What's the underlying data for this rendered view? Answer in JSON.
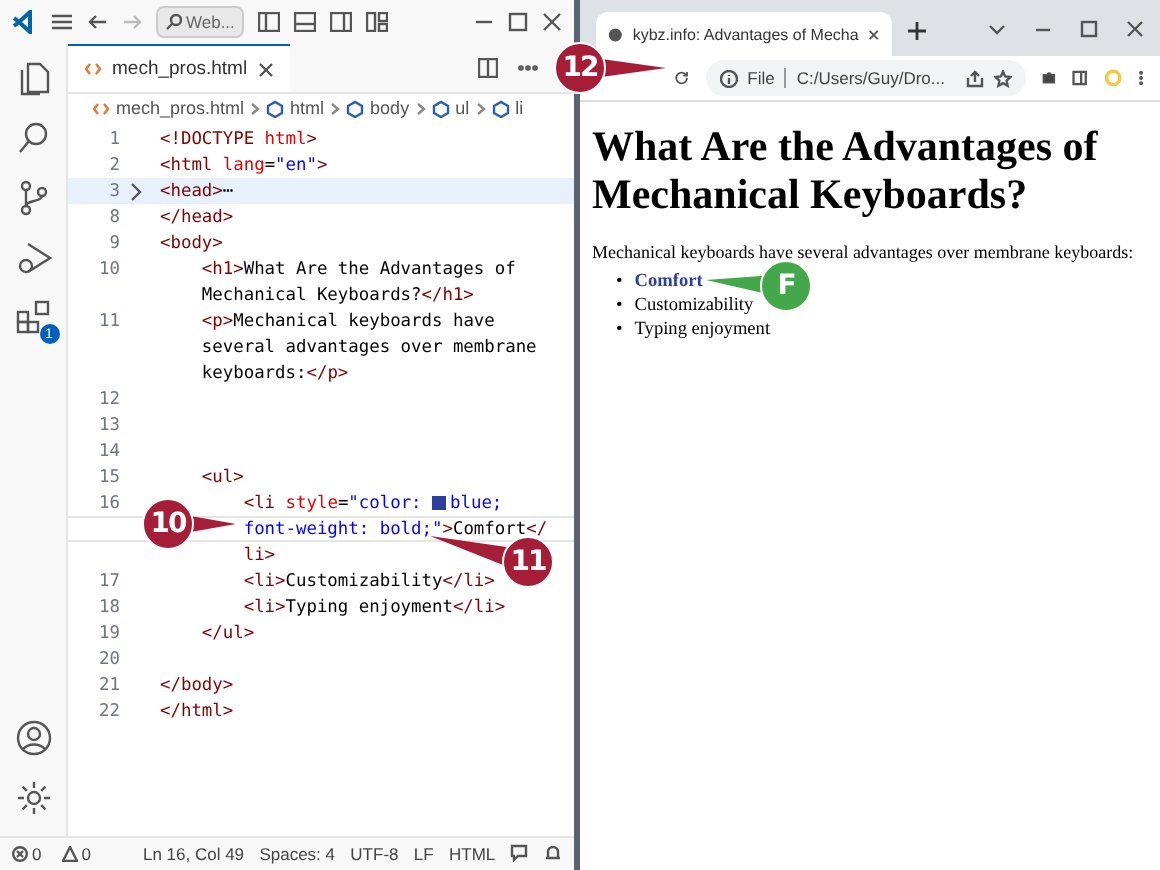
{
  "editor": {
    "search": "Web...",
    "tab": {
      "label": "mech_pros.html",
      "selected": true
    },
    "breadcrumb": [
      "mech_pros.html",
      "html",
      "body",
      "ul",
      "li"
    ],
    "extensions_badge": "1",
    "lines": [
      {
        "number": "1",
        "tokens": [
          {
            "text": "<!DOCTYPE",
            "kind": "tag"
          },
          {
            "text": " html",
            "kind": "attr"
          },
          {
            "text": ">",
            "kind": "tag"
          }
        ]
      },
      {
        "number": "2",
        "tokens": [
          {
            "text": "<html",
            "kind": "tag"
          },
          {
            "text": " lang",
            "kind": "attr"
          },
          {
            "text": "=",
            "kind": "text"
          },
          {
            "text": "\"en\"",
            "kind": "value"
          },
          {
            "text": ">",
            "kind": "tag"
          }
        ]
      },
      {
        "number": "3",
        "folded": true,
        "tokens": [
          {
            "text": "<head>",
            "kind": "tag"
          },
          {
            "text": "⋯",
            "kind": "text"
          }
        ]
      },
      {
        "number": "8",
        "tokens": [
          {
            "text": "</head>",
            "kind": "tag"
          }
        ]
      },
      {
        "number": "9",
        "tokens": [
          {
            "text": "<body>",
            "kind": "tag"
          }
        ]
      },
      {
        "number": "10",
        "tokens": [
          {
            "text": "    <h1>",
            "kind": "tag"
          },
          {
            "text": "What Are the Advantages of",
            "kind": "text"
          }
        ]
      },
      {
        "tokens": [
          {
            "text": "    Mechanical Keyboards?",
            "kind": "text"
          },
          {
            "text": "</h1>",
            "kind": "tag"
          }
        ]
      },
      {
        "number": "11",
        "tokens": [
          {
            "text": "    <p>",
            "kind": "tag"
          },
          {
            "text": "Mechanical keyboards have",
            "kind": "text"
          }
        ]
      },
      {
        "tokens": [
          {
            "text": "    several advantages over membrane",
            "kind": "text"
          }
        ]
      },
      {
        "tokens": [
          {
            "text": "    keyboards:",
            "kind": "text"
          },
          {
            "text": "</p>",
            "kind": "tag"
          }
        ]
      },
      {
        "number": "12"
      },
      {
        "number": "13"
      },
      {
        "number": "14"
      },
      {
        "number": "15",
        "tokens": [
          {
            "text": "    <ul>",
            "kind": "tag"
          }
        ]
      },
      {
        "number": "16",
        "tokens": [
          {
            "text": "        <li",
            "kind": "tag"
          },
          {
            "text": " style",
            "kind": "attr"
          },
          {
            "text": "=",
            "kind": "text"
          },
          {
            "text": "\"color: ",
            "kind": "value"
          },
          {
            "kind": "swatch",
            "color": "#2b3f9e"
          },
          {
            "text": "blue;",
            "kind": "value"
          }
        ]
      },
      {
        "current": true,
        "tokens": [
          {
            "text": "        font-weight: bold;\"",
            "kind": "value"
          },
          {
            "text": ">",
            "kind": "tag"
          },
          {
            "text": "Comfort",
            "kind": "text"
          },
          {
            "text": "</",
            "kind": "tag"
          }
        ]
      },
      {
        "tokens": [
          {
            "text": "        li>",
            "kind": "tag"
          }
        ]
      },
      {
        "number": "17",
        "tokens": [
          {
            "text": "        <li>",
            "kind": "tag"
          },
          {
            "text": "Customizability",
            "kind": "text"
          },
          {
            "text": "</li>",
            "kind": "tag"
          }
        ]
      },
      {
        "number": "18",
        "tokens": [
          {
            "text": "        <li>",
            "kind": "tag"
          },
          {
            "text": "Typing enjoyment",
            "kind": "text"
          },
          {
            "text": "</li>",
            "kind": "tag"
          }
        ]
      },
      {
        "number": "19",
        "tokens": [
          {
            "text": "    </ul>",
            "kind": "tag"
          }
        ]
      },
      {
        "number": "20"
      },
      {
        "number": "21",
        "tokens": [
          {
            "text": "</body>",
            "kind": "tag"
          }
        ]
      },
      {
        "number": "22",
        "tokens": [
          {
            "text": "</html>",
            "kind": "tag"
          }
        ]
      }
    ],
    "status_bar": {
      "errors": "0",
      "warnings": "0",
      "items": [
        "Ln 16, Col 49",
        "Spaces: 4",
        "UTF-8",
        "LF",
        "HTML"
      ]
    }
  },
  "browser": {
    "tab": {
      "title": "kybz.info: Advantages of Mecha",
      "selected": true
    },
    "address": {
      "scheme": "File",
      "url": "C:/Users/Guy/Dro..."
    },
    "heading": "What Are the Advantages of Mechanical Keyboards?",
    "paragraph": "Mechanical keyboards have several advantages over membrane keyboards:",
    "list": [
      {
        "marker": "•",
        "text": "Comfort",
        "bold": true,
        "color": "#2b3f9e"
      },
      {
        "marker": "•",
        "text": "Customizability",
        "bold": false,
        "color": "#000000"
      },
      {
        "marker": "•",
        "text": "Typing enjoyment",
        "bold": false,
        "color": "#000000"
      }
    ]
  },
  "callouts": [
    {
      "label": "10",
      "kind": "step"
    },
    {
      "label": "11",
      "kind": "step"
    },
    {
      "label": "12",
      "kind": "step"
    },
    {
      "label": "F",
      "kind": "letter"
    }
  ]
}
